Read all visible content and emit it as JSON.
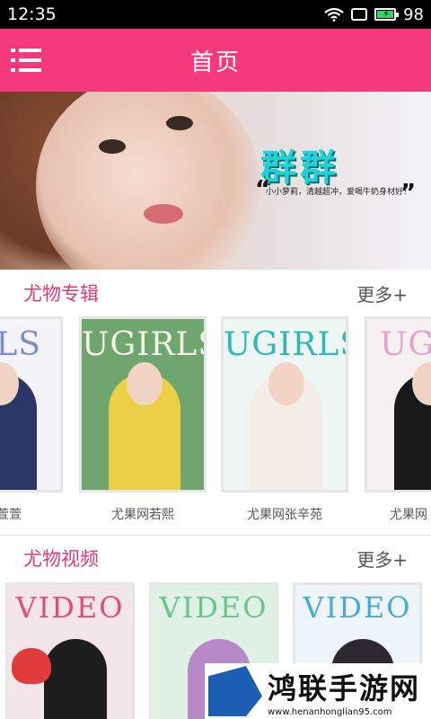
{
  "status_bar": {
    "time": "12:35",
    "battery": "98"
  },
  "app_bar": {
    "title": "首页"
  },
  "banner": {
    "title": "群群",
    "caption": "小小萝莉，清越超冲，爱喝牛奶身材好！",
    "quote_open": "“",
    "quote_close": "”",
    "dots": 3,
    "active_dot": 1
  },
  "albums_section": {
    "title": "尤物专辑",
    "more": "更多+",
    "items": [
      {
        "label": "果果萱萱",
        "brand": "IRLS",
        "color": "#b6c8e6"
      },
      {
        "label": "尤果网若熙",
        "brand": "UGIRLS",
        "color": "#6bb07a"
      },
      {
        "label": "尤果网张辛苑",
        "brand": "UGIRLS",
        "color": "#d9f1ef"
      },
      {
        "label": "尤果网",
        "brand": "UGI",
        "color": "#e9e4ea"
      }
    ]
  },
  "videos_section": {
    "title": "尤物视频",
    "more": "更多+",
    "items": [
      {
        "brand": "VIDEO",
        "color": "#e46a8c"
      },
      {
        "brand": "VIDEO",
        "color": "#9fd1a5"
      },
      {
        "brand": "VIDEO",
        "color": "#8fd0e8"
      }
    ]
  },
  "watermark": {
    "title": "鸿联手游网",
    "url": "www.henanhonglian95.com"
  }
}
